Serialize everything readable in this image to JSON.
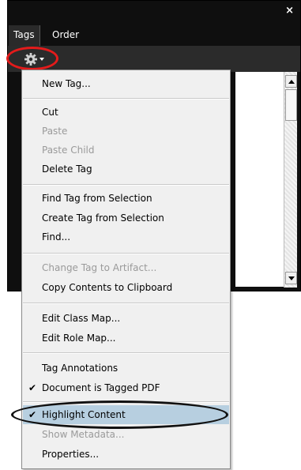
{
  "panel": {
    "close_label": "×",
    "tabs": [
      {
        "label": "Tags"
      },
      {
        "label": "Order"
      }
    ],
    "options_icon": "gear-icon"
  },
  "menu": {
    "items": [
      {
        "label": "New Tag...",
        "enabled": true
      },
      {
        "label": "Cut",
        "enabled": true
      },
      {
        "label": "Paste",
        "enabled": false
      },
      {
        "label": "Paste Child",
        "enabled": false
      },
      {
        "label": "Delete Tag",
        "enabled": true
      },
      {
        "label": "Find Tag from Selection",
        "enabled": true
      },
      {
        "label": "Create Tag from Selection",
        "enabled": true
      },
      {
        "label": "Find...",
        "enabled": true
      },
      {
        "label": "Change Tag to Artifact...",
        "enabled": false
      },
      {
        "label": "Copy Contents to Clipboard",
        "enabled": true
      },
      {
        "label": "Edit Class Map...",
        "enabled": true
      },
      {
        "label": "Edit Role Map...",
        "enabled": true
      },
      {
        "label": "Tag Annotations",
        "enabled": true
      },
      {
        "label": "Document is Tagged PDF",
        "enabled": true,
        "checked": true
      },
      {
        "label": "Highlight Content",
        "enabled": true,
        "checked": true,
        "highlighted": true
      },
      {
        "label": "Show Metadata...",
        "enabled": false
      },
      {
        "label": "Properties...",
        "enabled": true
      }
    ],
    "check_mark": "✔"
  },
  "colors": {
    "panel_bg": "#0f0f0f",
    "menu_bg": "#f0f0f0",
    "highlight_bg": "#b7cfe0",
    "annotation_red": "#e41b1b"
  }
}
